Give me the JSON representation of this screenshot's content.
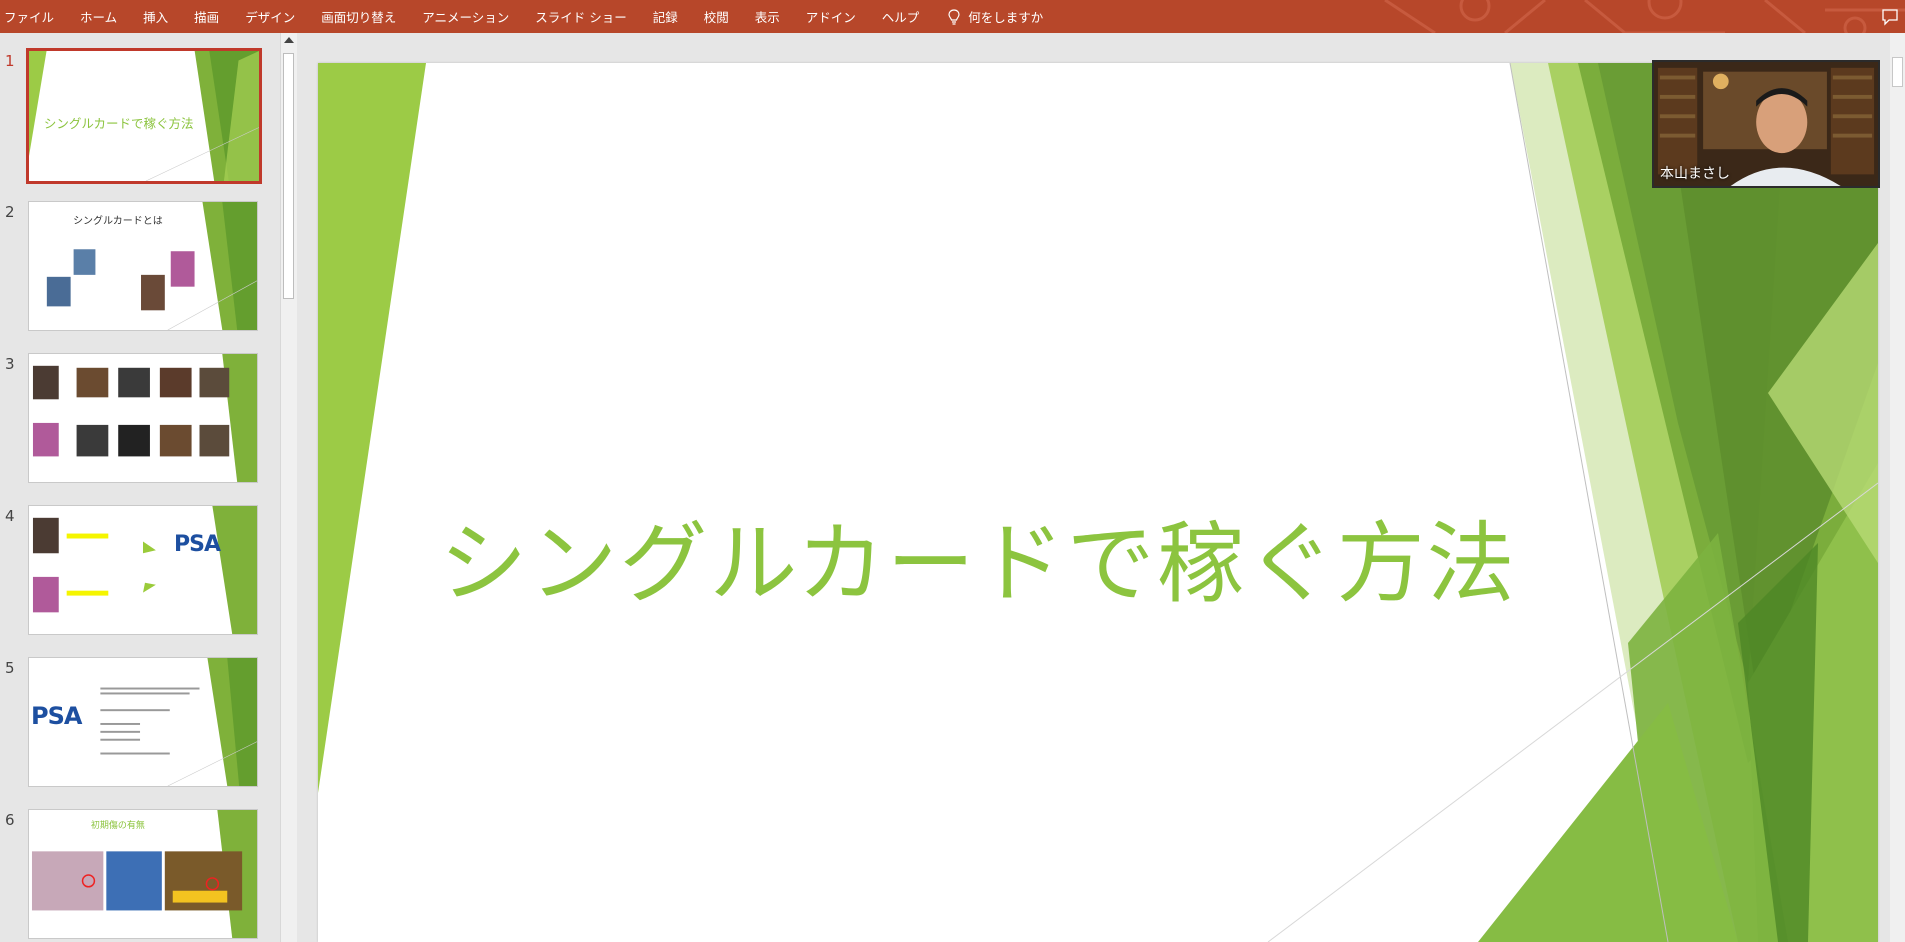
{
  "ribbon": {
    "tabs": [
      "ファイル",
      "ホーム",
      "挿入",
      "描画",
      "デザイン",
      "画面切り替え",
      "アニメーション",
      "スライド ショー",
      "記録",
      "校閲",
      "表示",
      "アドイン",
      "ヘルプ"
    ],
    "tell_me": "何をしますか"
  },
  "thumbnails": [
    {
      "num": "1",
      "title": "シングルカードで稼ぐ方法"
    },
    {
      "num": "2",
      "title": "シングルカードとは"
    },
    {
      "num": "3",
      "title": ""
    },
    {
      "num": "4",
      "title": ""
    },
    {
      "num": "5",
      "title": ""
    },
    {
      "num": "6",
      "title": "初期傷の有無"
    }
  ],
  "thumb_logo": "PSA",
  "slide": {
    "title": "シングルカードで稼ぐ方法"
  },
  "video": {
    "participant_name": "本山まさし"
  },
  "colors": {
    "ribbon": "#b7472a",
    "accent_green": "#8cc43f",
    "selected_border": "#c0392b"
  }
}
